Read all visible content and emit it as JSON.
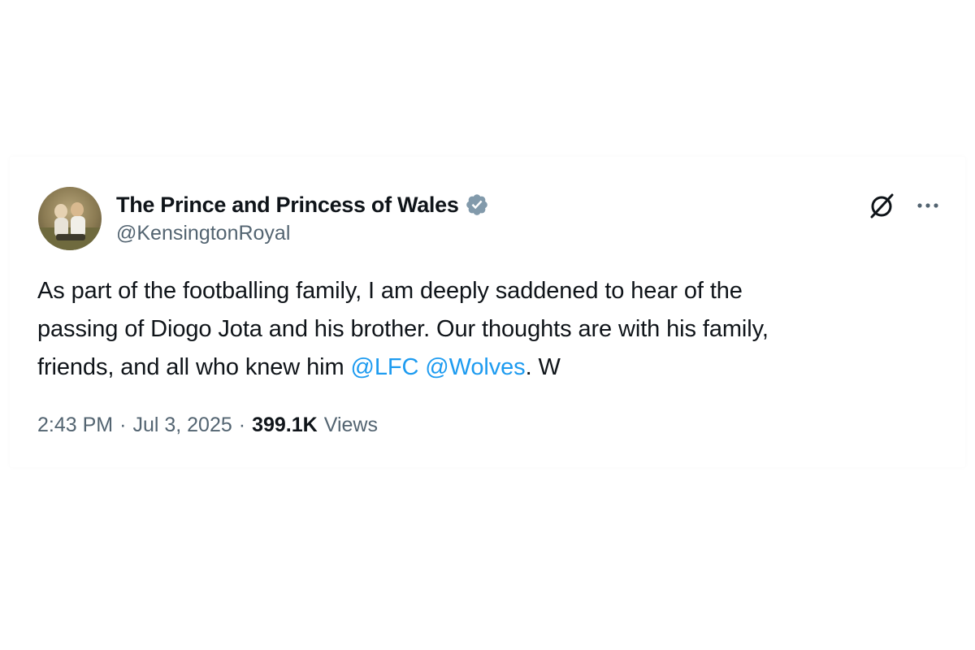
{
  "tweet": {
    "author": {
      "display_name": "The Prince and Princess of Wales",
      "handle": "@KensingtonRoyal",
      "verified_badge_color": "#829aab"
    },
    "text_parts": {
      "line1": "As part of the footballing family, I am deeply saddened to hear of the",
      "line2": "passing of Diogo Jota and his brother. Our thoughts are with his family,",
      "line3_prefix": "friends, and all who knew him ",
      "mention_1": "@LFC",
      "space": " ",
      "mention_2": "@Wolves",
      "line3_suffix": ". W"
    },
    "meta": {
      "time": "2:43 PM",
      "separator": "·",
      "date": "Jul 3, 2025",
      "views_count": "399.1K",
      "views_label": "Views"
    },
    "icons": {
      "verified": "verified-badge-icon",
      "grok": "grok-icon",
      "more": "more-options-icon"
    }
  },
  "colors": {
    "text_primary": "#0f1419",
    "text_secondary": "#536471",
    "link": "#1d9bf0"
  }
}
